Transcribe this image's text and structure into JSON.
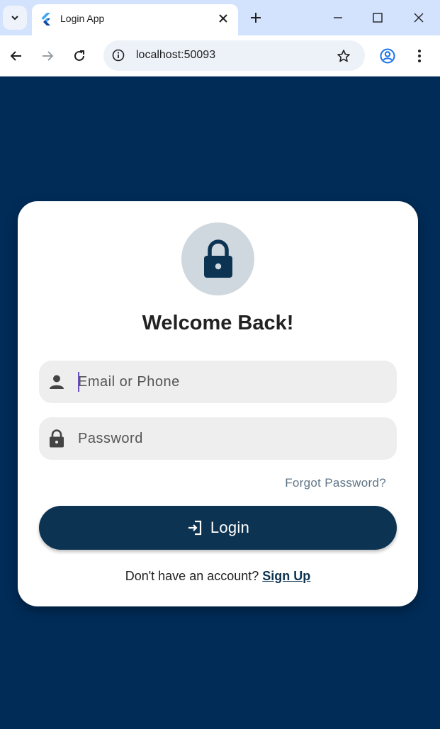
{
  "browser": {
    "tab_title": "Login App",
    "url": "localhost:50093"
  },
  "login": {
    "title": "Welcome Back!",
    "email_placeholder": "Email or Phone",
    "password_placeholder": "Password",
    "forgot_label": "Forgot Password?",
    "login_label": "Login",
    "signup_prompt": "Don't have an account?",
    "signup_link": "Sign Up"
  },
  "colors": {
    "background": "#012c58",
    "primary": "#0d3352",
    "field_bg": "#eeeeee",
    "lock_circle_bg": "#cfd8df"
  },
  "icons": {
    "tab_favicon": "flutter-icon",
    "email_field": "person-icon",
    "password_field": "lock-icon",
    "header": "lock-icon",
    "login_button": "login-icon"
  }
}
